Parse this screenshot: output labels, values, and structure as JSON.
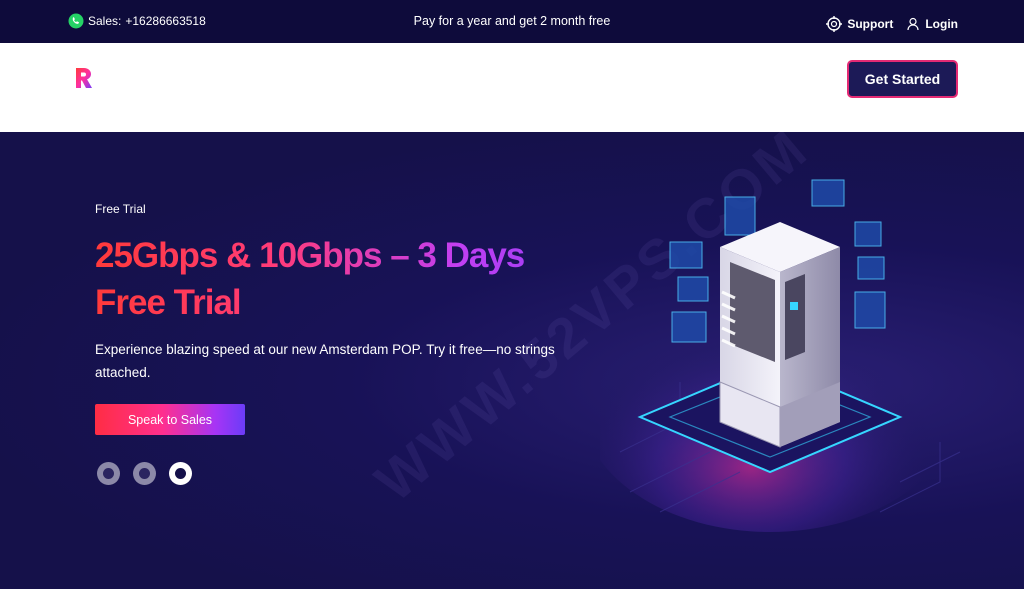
{
  "topbar": {
    "sales_label": "Sales:",
    "sales_phone": "+16286663518",
    "promo": "Pay for a year and get 2 month free",
    "support": "Support",
    "login": "Login"
  },
  "header": {
    "cta": "Get Started"
  },
  "hero": {
    "eyebrow": "Free Trial",
    "headline_line1": "25Gbps & 10Gbps – 3 Days",
    "headline_line2": "Free Trial",
    "subtitle": "Experience blazing speed at our new Amsterdam POP. Try it free—no strings attached.",
    "button": "Speak to Sales",
    "carousel": {
      "total": 3,
      "active": 3
    }
  },
  "watermark": "WWW.52VPS.COM",
  "icons": [
    "whatsapp-icon",
    "support-icon",
    "user-icon",
    "logo-icon"
  ],
  "colors": {
    "topbar_bg": "#0e0b3b",
    "hero_bg": "#15114a",
    "cta_bg": "#1c1a57",
    "cta_border": "#e42a74",
    "gradient_start": "#ff3a3a",
    "gradient_end": "#8a3cf7"
  }
}
